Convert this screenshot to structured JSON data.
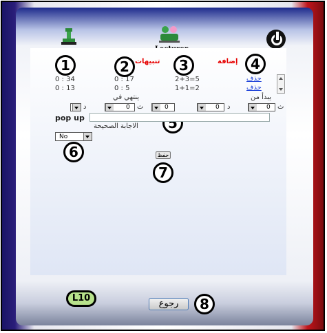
{
  "header": {
    "title": "Lecturer"
  },
  "columns": {
    "actions_header": "إضافة",
    "alerts_header": "تنبيهات"
  },
  "rows": [
    {
      "start": "0 : 34",
      "end": "0 : 17",
      "question": "2+3=5",
      "action": "حذف"
    },
    {
      "start": "0 : 13",
      "end": "0 : 5",
      "question": "1+1=2",
      "action": "حذف"
    }
  ],
  "form": {
    "ends_at_label": "ينتهي في",
    "starts_at_label": "يبدأ من",
    "sec_suffix": "ث",
    "min_suffix": "د",
    "ends_minutes": "0",
    "ends_seconds": "0",
    "starts_minutes": "0",
    "starts_seconds": "0",
    "popup_label": "pop up",
    "popup_value": "",
    "correct_answer_label": "الاجابة الصحيحة",
    "correct_answer_value": "No",
    "save_label": "حفظ"
  },
  "footer": {
    "level_badge": "L10",
    "back_label": "رجوع"
  },
  "callouts": [
    "1",
    "2",
    "3",
    "4",
    "5",
    "6",
    "7",
    "8"
  ],
  "colors": {
    "accent_red": "#e60000",
    "link_blue": "#1a3fd8",
    "badge_green": "#b8e28c"
  }
}
